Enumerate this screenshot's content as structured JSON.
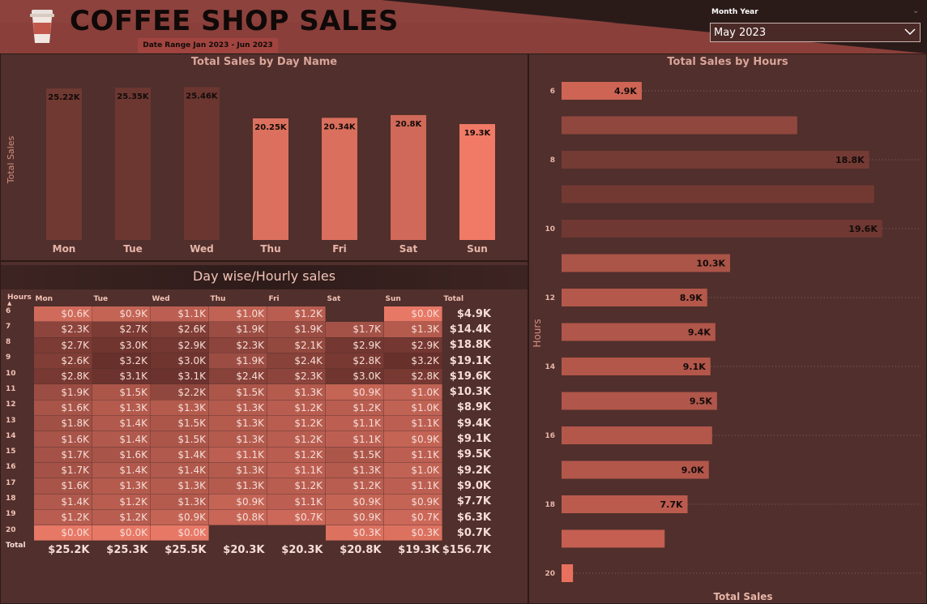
{
  "header": {
    "title": "COFFEE SHOP SALES",
    "date_range": "Date Range Jan 2023 - Jun 2023",
    "slicer_label": "Month Year",
    "slicer_value": "May 2023",
    "logo_icon": "coffee-cup-icon"
  },
  "colors": {
    "background": "#4e2e2b",
    "bar_dark": "#6b3630",
    "bar_light": "#f07a66",
    "accent": "#d86552"
  },
  "matrix": {
    "title": "Day wise/Hourly sales",
    "hours_header": "Hours",
    "columns": [
      "Mon",
      "Tue",
      "Wed",
      "Thu",
      "Fri",
      "Sat",
      "Sun"
    ],
    "total_header": "Total",
    "rows": [
      {
        "hour": "6",
        "cells": [
          "$0.6K",
          "$0.9K",
          "$1.1K",
          "$1.0K",
          "$1.2K",
          "",
          "$0.0K"
        ],
        "total": "$4.9K"
      },
      {
        "hour": "7",
        "cells": [
          "$2.3K",
          "$2.7K",
          "$2.6K",
          "$1.9K",
          "$1.9K",
          "$1.7K",
          "$1.3K"
        ],
        "total": "$14.4K"
      },
      {
        "hour": "8",
        "cells": [
          "$2.7K",
          "$3.0K",
          "$2.9K",
          "$2.3K",
          "$2.1K",
          "$2.9K",
          "$2.9K"
        ],
        "total": "$18.8K"
      },
      {
        "hour": "9",
        "cells": [
          "$2.6K",
          "$3.2K",
          "$3.0K",
          "$1.9K",
          "$2.4K",
          "$2.8K",
          "$3.2K"
        ],
        "total": "$19.1K"
      },
      {
        "hour": "10",
        "cells": [
          "$2.8K",
          "$3.1K",
          "$3.1K",
          "$2.4K",
          "$2.3K",
          "$3.0K",
          "$2.8K"
        ],
        "total": "$19.6K"
      },
      {
        "hour": "11",
        "cells": [
          "$1.9K",
          "$1.5K",
          "$2.2K",
          "$1.5K",
          "$1.3K",
          "$0.9K",
          "$1.0K"
        ],
        "total": "$10.3K"
      },
      {
        "hour": "12",
        "cells": [
          "$1.6K",
          "$1.3K",
          "$1.3K",
          "$1.3K",
          "$1.2K",
          "$1.2K",
          "$1.0K"
        ],
        "total": "$8.9K"
      },
      {
        "hour": "13",
        "cells": [
          "$1.8K",
          "$1.4K",
          "$1.5K",
          "$1.3K",
          "$1.2K",
          "$1.1K",
          "$1.1K"
        ],
        "total": "$9.4K"
      },
      {
        "hour": "14",
        "cells": [
          "$1.6K",
          "$1.4K",
          "$1.5K",
          "$1.3K",
          "$1.2K",
          "$1.1K",
          "$0.9K"
        ],
        "total": "$9.1K"
      },
      {
        "hour": "15",
        "cells": [
          "$1.7K",
          "$1.6K",
          "$1.4K",
          "$1.1K",
          "$1.2K",
          "$1.5K",
          "$1.1K"
        ],
        "total": "$9.5K"
      },
      {
        "hour": "16",
        "cells": [
          "$1.7K",
          "$1.4K",
          "$1.4K",
          "$1.3K",
          "$1.1K",
          "$1.3K",
          "$1.0K"
        ],
        "total": "$9.2K"
      },
      {
        "hour": "17",
        "cells": [
          "$1.6K",
          "$1.3K",
          "$1.3K",
          "$1.3K",
          "$1.2K",
          "$1.2K",
          "$1.1K"
        ],
        "total": "$9.0K"
      },
      {
        "hour": "18",
        "cells": [
          "$1.4K",
          "$1.2K",
          "$1.3K",
          "$0.9K",
          "$1.1K",
          "$0.9K",
          "$0.9K"
        ],
        "total": "$7.7K"
      },
      {
        "hour": "19",
        "cells": [
          "$1.2K",
          "$1.2K",
          "$0.9K",
          "$0.8K",
          "$0.7K",
          "$0.9K",
          "$0.7K"
        ],
        "total": "$6.3K"
      },
      {
        "hour": "20",
        "cells": [
          "$0.0K",
          "$0.0K",
          "$0.0K",
          "",
          "",
          "$0.3K",
          "$0.3K"
        ],
        "total": "$0.7K"
      }
    ],
    "total_row": {
      "label": "Total",
      "cells": [
        "$25.2K",
        "$25.3K",
        "$25.5K",
        "$20.3K",
        "$20.3K",
        "$20.8K",
        "$19.3K"
      ],
      "total": "$156.7K"
    }
  },
  "chart_data": [
    {
      "type": "bar",
      "title": "Total Sales by Day Name",
      "xlabel": "",
      "ylabel": "Total Sales",
      "categories": [
        "Mon",
        "Tue",
        "Wed",
        "Thu",
        "Fri",
        "Sat",
        "Sun"
      ],
      "values": [
        25.22,
        25.35,
        25.46,
        20.25,
        20.34,
        20.8,
        19.3
      ],
      "labels": [
        "25.22K",
        "25.35K",
        "25.46K",
        "20.25K",
        "20.34K",
        "20.8K",
        "19.3K"
      ],
      "ylim": [
        0,
        27
      ],
      "grid": false
    },
    {
      "type": "bar",
      "orientation": "horizontal",
      "title": "Total Sales by Hours",
      "xlabel": "Total Sales",
      "ylabel": "Hours",
      "categories": [
        "6",
        "7",
        "8",
        "9",
        "10",
        "11",
        "12",
        "13",
        "14",
        "15",
        "16",
        "17",
        "18",
        "19",
        "20"
      ],
      "tick_labels": [
        "6",
        "",
        "8",
        "",
        "10",
        "",
        "12",
        "",
        "14",
        "",
        "16",
        "",
        "18",
        "",
        "20"
      ],
      "values": [
        4.9,
        14.4,
        18.8,
        19.1,
        19.6,
        10.3,
        8.9,
        9.4,
        9.1,
        9.5,
        9.2,
        9.0,
        7.7,
        6.3,
        0.7
      ],
      "labels": [
        "4.9K",
        "",
        "18.8K",
        "",
        "19.6K",
        "10.3K",
        "8.9K",
        "9.4K",
        "9.1K",
        "9.5K",
        "",
        "9.0K",
        "7.7K",
        "",
        ""
      ],
      "grid": false
    }
  ]
}
